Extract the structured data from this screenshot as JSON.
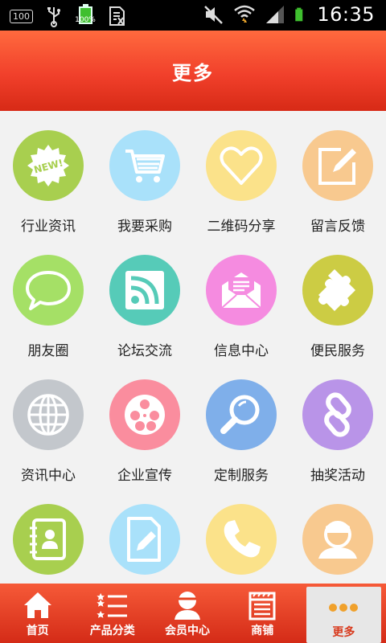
{
  "status": {
    "time": "16:35",
    "badge": "100",
    "battery_small": "100%"
  },
  "header": {
    "title": "更多"
  },
  "grid": {
    "items": [
      {
        "label": "行业资讯",
        "icon": "new-badge-icon",
        "color": "#a8cf4f"
      },
      {
        "label": "我要采购",
        "icon": "cart-icon",
        "color": "#7ed3f6"
      },
      {
        "label": "二维码分享",
        "icon": "heart-icon",
        "color": "#f9df6e"
      },
      {
        "label": "留言反馈",
        "icon": "edit-icon",
        "color": "#f7bb73"
      },
      {
        "label": "朋友圈",
        "icon": "chat-bubble-icon",
        "color": "#9bdc59"
      },
      {
        "label": "论坛交流",
        "icon": "rss-icon",
        "color": "#4bc9b6"
      },
      {
        "label": "信息中心",
        "icon": "mail-icon",
        "color": "#f580dc"
      },
      {
        "label": "便民服务",
        "icon": "puzzle-icon",
        "color": "#c6c93a"
      },
      {
        "label": "资讯中心",
        "icon": "globe-icon",
        "color": "#bfc3c8"
      },
      {
        "label": "企业宣传",
        "icon": "film-reel-icon",
        "color": "#f87e93"
      },
      {
        "label": "定制服务",
        "icon": "magnifier-icon",
        "color": "#6ea4e8"
      },
      {
        "label": "抽奖活动",
        "icon": "link-icon",
        "color": "#b58ce6"
      },
      {
        "label": "",
        "icon": "contacts-icon",
        "color": "#a8cf4f"
      },
      {
        "label": "",
        "icon": "document-edit-icon",
        "color": "#7ed3f6"
      },
      {
        "label": "",
        "icon": "phone-icon",
        "color": "#f9df6e"
      },
      {
        "label": "",
        "icon": "user-icon",
        "color": "#f7bb73"
      }
    ]
  },
  "nav": {
    "items": [
      {
        "label": "首页",
        "icon": "home-icon"
      },
      {
        "label": "产品分类",
        "icon": "list-icon"
      },
      {
        "label": "会员中心",
        "icon": "member-icon"
      },
      {
        "label": "商铺",
        "icon": "shop-icon"
      },
      {
        "label": "更多",
        "icon": "more-dots-icon",
        "active": true
      }
    ]
  }
}
